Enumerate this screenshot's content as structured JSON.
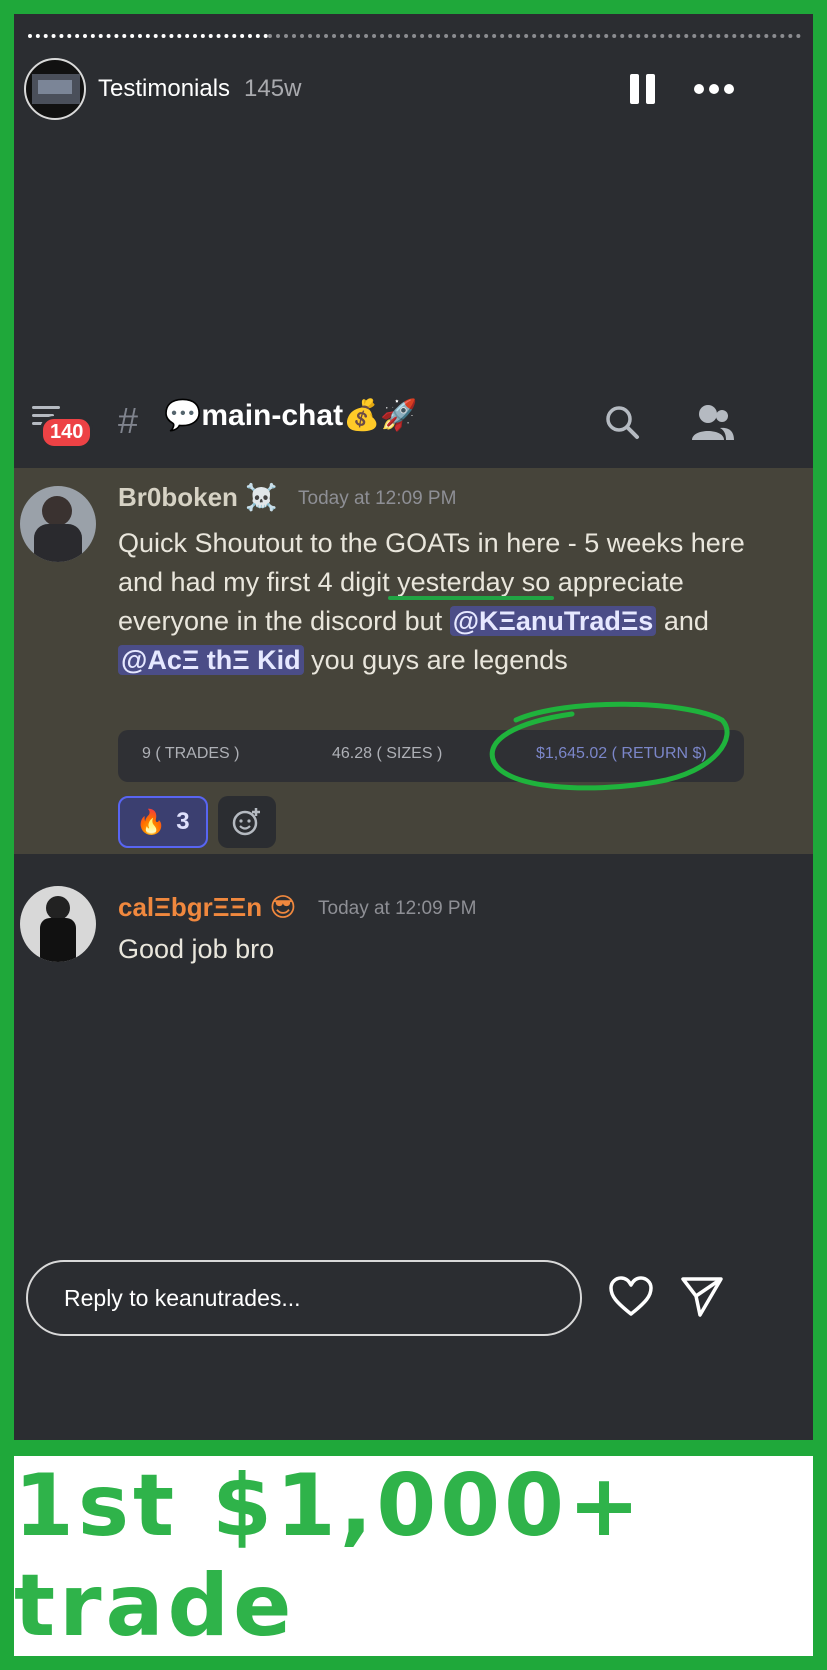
{
  "story": {
    "title": "Testimonials",
    "age": "145w",
    "reply_placeholder": "Reply to keanutrades..."
  },
  "channel": {
    "badge": "140",
    "hash": "#",
    "name": "main-chat",
    "prefix_emoji": "💬",
    "suffix_emoji": "💰🚀"
  },
  "messages": [
    {
      "username": "Br0boken",
      "badge_emoji": "☠️",
      "timestamp": "Today at 12:09 PM",
      "text_1": "Quick Shoutout to the GOATs in here - 5 weeks here and had my first 4 digit yesterday so appreciate everyone in the discord but ",
      "mention_1": "@KΞanuTradΞs",
      "text_2": " and ",
      "mention_2": "@AcΞ thΞ Kid",
      "text_3": " you guys are legends",
      "embed": {
        "trades": "9 ( TRADES )",
        "sizes": "46.28 ( SIZES )",
        "return": "$1,645.02 ( RETURN $)"
      },
      "reaction": {
        "emoji": "🔥",
        "count": "3"
      }
    },
    {
      "username": "calΞbgrΞΞn",
      "badge_emoji": "😎",
      "timestamp": "Today at 12:09 PM",
      "text": "Good job bro"
    }
  ],
  "caption": "1st $1,000+ trade",
  "colors": {
    "frame_green": "#1fa83a",
    "discord_bg": "#2b2d31",
    "highlight_bg": "#46443a",
    "username_orange": "#f0883e",
    "mention_bg": "#4b4d87",
    "badge_red": "#ed4245"
  }
}
